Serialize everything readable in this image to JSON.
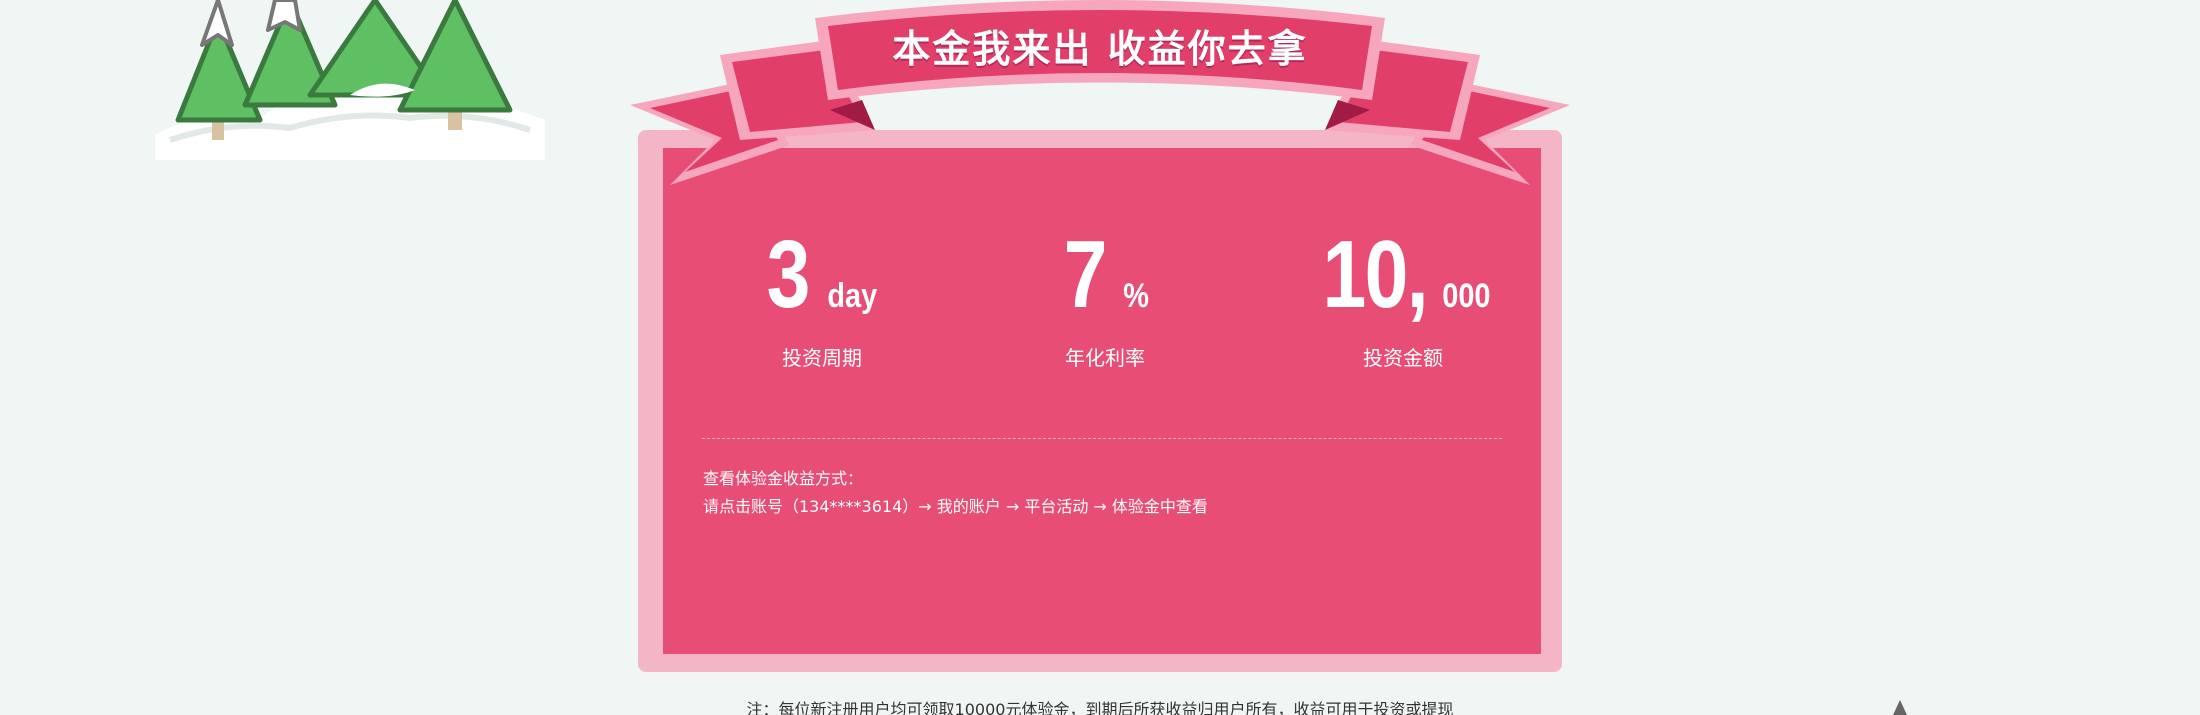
{
  "banner": {
    "title": "本金我来出 收益你去拿"
  },
  "stats": [
    {
      "value": "3",
      "unit": "day",
      "label": "投资周期"
    },
    {
      "value": "7",
      "unit": "%",
      "label": "年化利率"
    },
    {
      "value": "10,",
      "unit": "000",
      "label": "投资金额"
    }
  ],
  "info": {
    "heading": "查看体验金收益方式：",
    "steps": "请点击账号（134****3614）→ 我的账户 → 平台活动 → 体验金中查看"
  },
  "note": "注：每位新注册用户均可领取10000元体验金，到期后所获收益归用户所有，收益可用于投资或提现",
  "colors": {
    "background": "#f0f6f4",
    "card_inner": "#e84d75",
    "card_outer": "#f4b6c7",
    "ribbon": "#e23e6a",
    "ribbon_border": "#f6a7bd",
    "tree_green": "#5fbf63",
    "tree_outline": "#3b7a3e"
  }
}
